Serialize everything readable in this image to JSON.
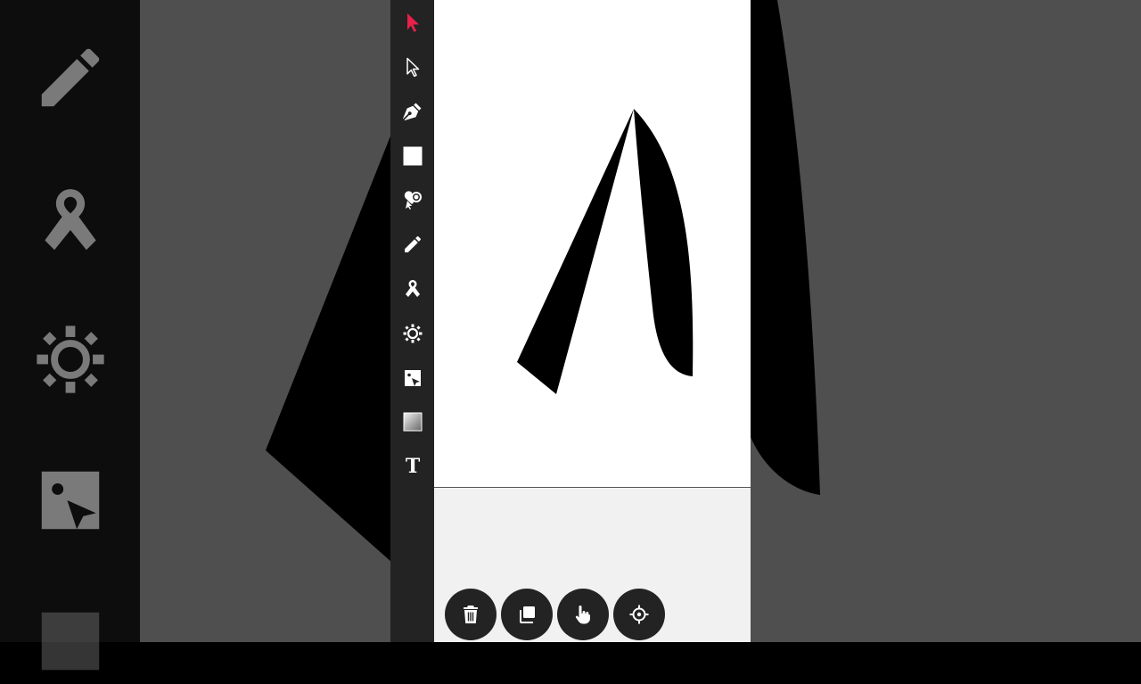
{
  "toolbar": {
    "tools": [
      {
        "name": "select-tool",
        "icon": "arrow-pointer-icon",
        "active": true
      },
      {
        "name": "direct-select-tool",
        "icon": "arrow-pointer-outline-icon"
      },
      {
        "name": "pen-tool",
        "icon": "pen-nib-icon"
      },
      {
        "name": "rectangle-tool",
        "icon": "square-icon"
      },
      {
        "name": "shapes-tool",
        "icon": "shapes-icon"
      },
      {
        "name": "pencil-tool",
        "icon": "pencil-icon"
      },
      {
        "name": "ribbon-tool",
        "icon": "ribbon-icon"
      },
      {
        "name": "gear-shape-tool",
        "icon": "gear-icon"
      },
      {
        "name": "image-tool",
        "icon": "image-icon"
      },
      {
        "name": "gradient-tool",
        "icon": "gradient-square-icon"
      },
      {
        "name": "text-tool",
        "icon": "text-icon",
        "glyph": "T"
      }
    ]
  },
  "colors": {
    "toolbar_bg": "#232323",
    "active_tool": "#e8204a",
    "icon": "#ffffff",
    "canvas_bg": "#ffffff",
    "panel_bg": "#f1f1f1",
    "shape_fill": "#000000"
  },
  "actions": [
    {
      "name": "delete-button",
      "icon": "trash-icon"
    },
    {
      "name": "duplicate-button",
      "icon": "copy-icon"
    },
    {
      "name": "pan-button",
      "icon": "hand-pointer-icon"
    },
    {
      "name": "recenter-button",
      "icon": "crosshair-icon"
    }
  ]
}
